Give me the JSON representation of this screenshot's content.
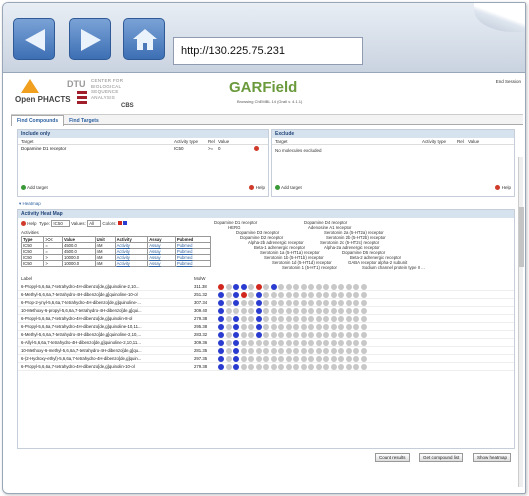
{
  "browser": {
    "url": "http://130.225.75.231"
  },
  "header": {
    "logo_name": "Open PHACTS",
    "dtu_label": "DTU",
    "center_lines": [
      "CENTER FOR",
      "BIOLOGICAL",
      "SEQUENCE",
      "ANALYSIS"
    ],
    "cbs_label": "CBS",
    "app_title": "GARField",
    "app_subtitle": "Browsing ChEMBL 14 (GraIl v. 4.1.1)",
    "end_session": "End Session"
  },
  "tabs": [
    "Find Compounds",
    "Find Targets"
  ],
  "include": {
    "title": "Include only",
    "col_target": "Target",
    "col_activity": "Activity type",
    "col_rel": "Rel",
    "col_value": "Value",
    "row_target": "Dopamine D1 receptor",
    "row_activity": "IC50",
    "row_rel": ">=",
    "row_value": "0",
    "add_target": "Add target",
    "help": "Help"
  },
  "exclude": {
    "title": "Exclude",
    "col_target": "Target",
    "col_activity": "Activity type",
    "col_rel": "Rel",
    "col_value": "Value",
    "empty_msg": "No molecules excluded",
    "add_target": "Add target",
    "help": "Help"
  },
  "heatmap_toggle": "Heatmap",
  "activity": {
    "title": "Activity Heat Map",
    "help": "Help",
    "type_label": "Type:",
    "type_value": "IC50",
    "values_label": "Values:",
    "values_value": "All",
    "colors_label": "Colors:",
    "activities_label": "Activities",
    "table_headers": [
      "Type",
      ">=<",
      "Value",
      "Unit",
      "Activity",
      "Assay",
      "Pubmed"
    ],
    "table_rows": [
      [
        "IC50",
        "=",
        "4500.0",
        "nM",
        "Activity",
        "Assay",
        "Pubmed"
      ],
      [
        "IC50",
        "=",
        "4500.0",
        "nM",
        "Activity",
        "Assay",
        "Pubmed"
      ],
      [
        "IC50",
        ">",
        "10000.0",
        "nM",
        "Activity",
        "Assay",
        "Pubmed"
      ],
      [
        "IC50",
        ">",
        "10000.0",
        "nM",
        "Activity",
        "Assay",
        "Pubmed"
      ]
    ],
    "col_label": "Label",
    "col_molw": "MolW",
    "compounds": [
      {
        "label": "6-Propyl-5,6,6a,7-tetrahydro-4H-dibenzo[de,g]quinoline-2,10...",
        "molw": "311.38"
      },
      {
        "label": "6-Methyl-5,6,6a,7-tetrahydro-4H-dibenzo[de,g]quinoline-10-ol",
        "molw": "251.32"
      },
      {
        "label": "6-Prop-2-ynyl-5,6,6a,7-tetrahydro-4H-dibenzo[de,g]quinoline-...",
        "molw": "307.34"
      },
      {
        "label": "10-Methoxy-6-propyl-5,6,6a,7-tetrahydro-4H-dibenzo[de,g]qui...",
        "molw": "309.40"
      },
      {
        "label": "6-Propyl-5,6,6a,7-tetrahydro-4H-dibenzo[de,g]quinolin-8-ol",
        "molw": "279.38"
      },
      {
        "label": "6-Propyl-5,6,6a,7-tetrahydro-4H-dibenzo[de,g]quinoline-10,11...",
        "molw": "295.38"
      },
      {
        "label": "6-Methyl-5,6,6a,7-tetrahydro-4H-dibenzo[de,g]quinoline-2,10,...",
        "molw": "283.32"
      },
      {
        "label": "6-Allyl-5,6,6a,7-tetrahydro-4H-dibenzo[de,g]quinoline-2,10,11...",
        "molw": "309.36"
      },
      {
        "label": "10-Methoxy-6-methyl-5,6,6a,7-tetrahydro-4H-dibenzo[de,g]qu...",
        "molw": "281.35"
      },
      {
        "label": "6-(2-Hydroxy-ethyl)-5,6,6a,7-tetrahydro-4H-dibenzo[de,g]quin...",
        "molw": "297.35"
      },
      {
        "label": "6-Propyl-5,6,6a,7-tetrahydro-4H-dibenzo[de,g]quinolin-10-ol",
        "molw": "279.38"
      }
    ],
    "targets": [
      "Dopamine D1 receptor",
      "HERG",
      "Dopamine D4 receptor",
      "Adenosine A1 receptor",
      "Dopamine D3 receptor",
      "Serotonin 2a (5-HT2a) receptor",
      "Dopamine D2 receptor",
      "Serotonin 2b (5-HT2b) receptor",
      "Alpha-2b adrenergic receptor",
      "Serotonin 2c (5-HT2c) receptor",
      "Beta-1 adrenergic receptor",
      "Alpha-2a adrenergic receptor",
      "Serotonin 1a (5-HT1a) receptor",
      "Dopamine D5 receptor",
      "Serotonin 1b (5-HT1b) receptor",
      "Beta-2 adrenergic receptor",
      "Serotonin 1d (5-HT1d) receptor",
      "GABA receptor alpha-2 subunit",
      "Serotonin 1 (5-HT1) receptor",
      "Sodium channel protein type II ..."
    ],
    "colors": {
      "blue": "#2a3bd0",
      "red": "#d0281e",
      "grey": "#c8c8c8"
    }
  },
  "buttons": {
    "count": "Count results",
    "get_list": "Get compound list",
    "show_heatmap": "Show heatmap"
  }
}
